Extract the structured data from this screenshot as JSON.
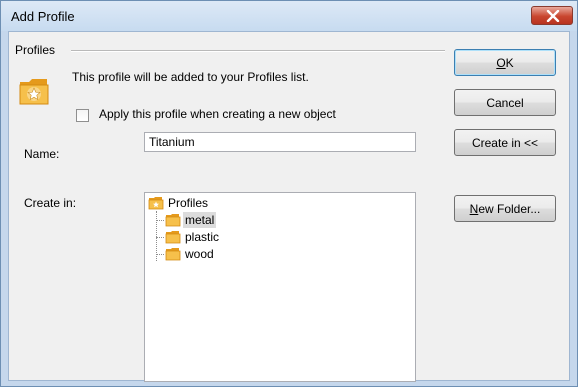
{
  "window": {
    "title": "Add Profile"
  },
  "profiles_group": {
    "label": "Profiles",
    "description": "This profile will be added to your Profiles list.",
    "apply_checkbox": {
      "label": "Apply this profile when creating a new object",
      "checked": false
    }
  },
  "name_field": {
    "label": "Name:",
    "value": "Titanium"
  },
  "create_in": {
    "label": "Create in:",
    "tree": {
      "root": "Profiles",
      "children": [
        "metal",
        "plastic",
        "wood"
      ],
      "selected": "metal"
    }
  },
  "buttons": {
    "ok": {
      "accel": "O",
      "rest": "K"
    },
    "cancel": "Cancel",
    "create_in": "Create in <<",
    "new_folder": {
      "accel": "N",
      "rest": "ew Folder..."
    }
  },
  "colors": {
    "titlebar": "#c7dbf0",
    "close_button": "#c9462f",
    "folder": "#f4b43a",
    "dialog_bg": "#f0f0f0"
  },
  "icons": [
    "close-icon",
    "profile-star-icon",
    "folder-icon",
    "open-folder-icon"
  ]
}
